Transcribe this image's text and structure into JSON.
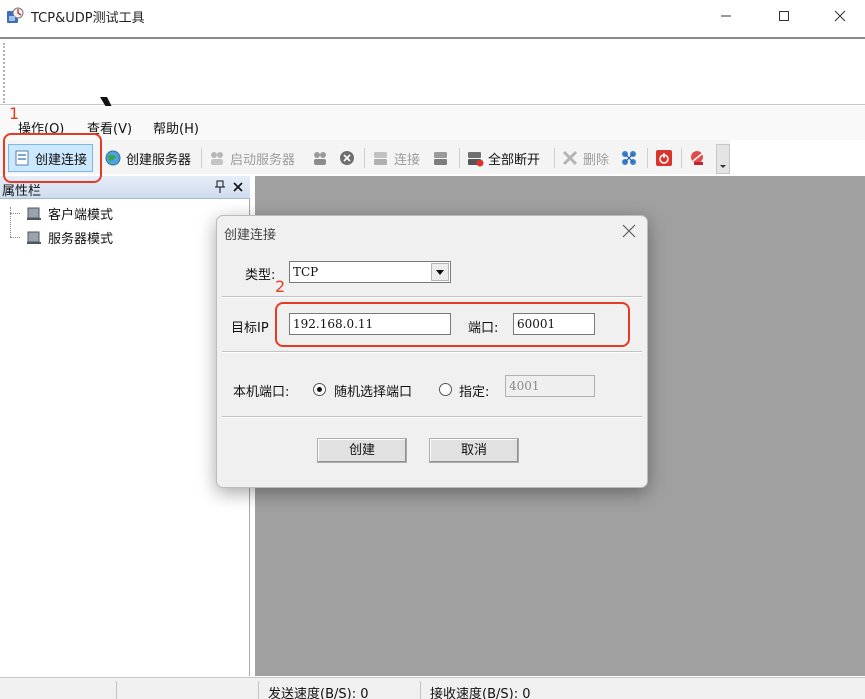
{
  "window": {
    "title": "TCP&UDP测试工具"
  },
  "menu": {
    "items": [
      "操作(O)",
      "查看(V)",
      "帮助(H)"
    ]
  },
  "toolbar": {
    "create_connection": "创建连接",
    "create_server": "创建服务器",
    "start_server": "启动服务器",
    "connect": "连接",
    "disconnect_all": "全部断开",
    "delete": "删除"
  },
  "panel": {
    "title": "属性栏",
    "pin_glyph": "ᵠ",
    "items": [
      "客户端模式",
      "服务器模式"
    ]
  },
  "dialog": {
    "title": "创建连接",
    "type_label": "类型:",
    "type_value": "TCP",
    "target_ip_label": "目标IP",
    "target_ip_value": "192.168.0.11",
    "port_label": "端口:",
    "port_value": "60001",
    "local_port_label": "本机端口:",
    "random_port_label": "随机选择端口",
    "specify_label": "指定:",
    "specify_value": "4001",
    "create_button": "创建",
    "cancel_button": "取消"
  },
  "status": {
    "send_speed": "发送速度(B/S): 0",
    "recv_speed": "接收速度(B/S): 0"
  },
  "annotations": {
    "step1": "1",
    "step2": "2"
  },
  "colors": {
    "annotation": "#e53b24",
    "workspace": "#a0a0a0",
    "toolbar_highlight": "#cce8ff"
  }
}
